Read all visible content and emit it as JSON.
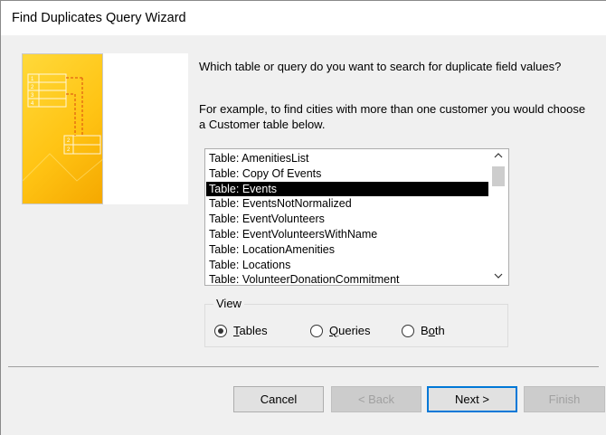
{
  "window": {
    "title": "Find Duplicates Query Wizard"
  },
  "prompt": "Which table or query do you want to search for duplicate field values?",
  "example": "For example, to find cities with more than one customer you would choose a Customer table below.",
  "list": {
    "items": [
      "Table: AmenitiesList",
      "Table: Copy Of Events",
      "Table: Events",
      "Table: EventsNotNormalized",
      "Table: EventVolunteers",
      "Table: EventVolunteersWithName",
      "Table: LocationAmenities",
      "Table: Locations",
      "Table: VolunteerDonationCommitment"
    ],
    "selected_index": 2,
    "scroll_up_icon": "chevron-up-icon",
    "scroll_down_icon": "chevron-down-icon"
  },
  "view": {
    "legend": "View",
    "options": [
      {
        "label_mnemonic": "T",
        "label_rest": "ables",
        "checked": true
      },
      {
        "label_mnemonic": "Q",
        "label_rest": "ueries",
        "checked": false
      },
      {
        "label_mnemonic": "o",
        "label_pre": "B",
        "label_rest": "th",
        "checked": false
      }
    ]
  },
  "buttons": {
    "cancel": "Cancel",
    "back": "< Back",
    "next": "Next >",
    "finish": "Finish"
  },
  "illustration": {
    "row_labels_top": [
      "1",
      "2",
      "3",
      "4"
    ],
    "row_labels_bottom": [
      "2",
      "2"
    ]
  },
  "colors": {
    "accent": "#0078d7",
    "selection": "#000000",
    "illustration": "#ffc414"
  }
}
